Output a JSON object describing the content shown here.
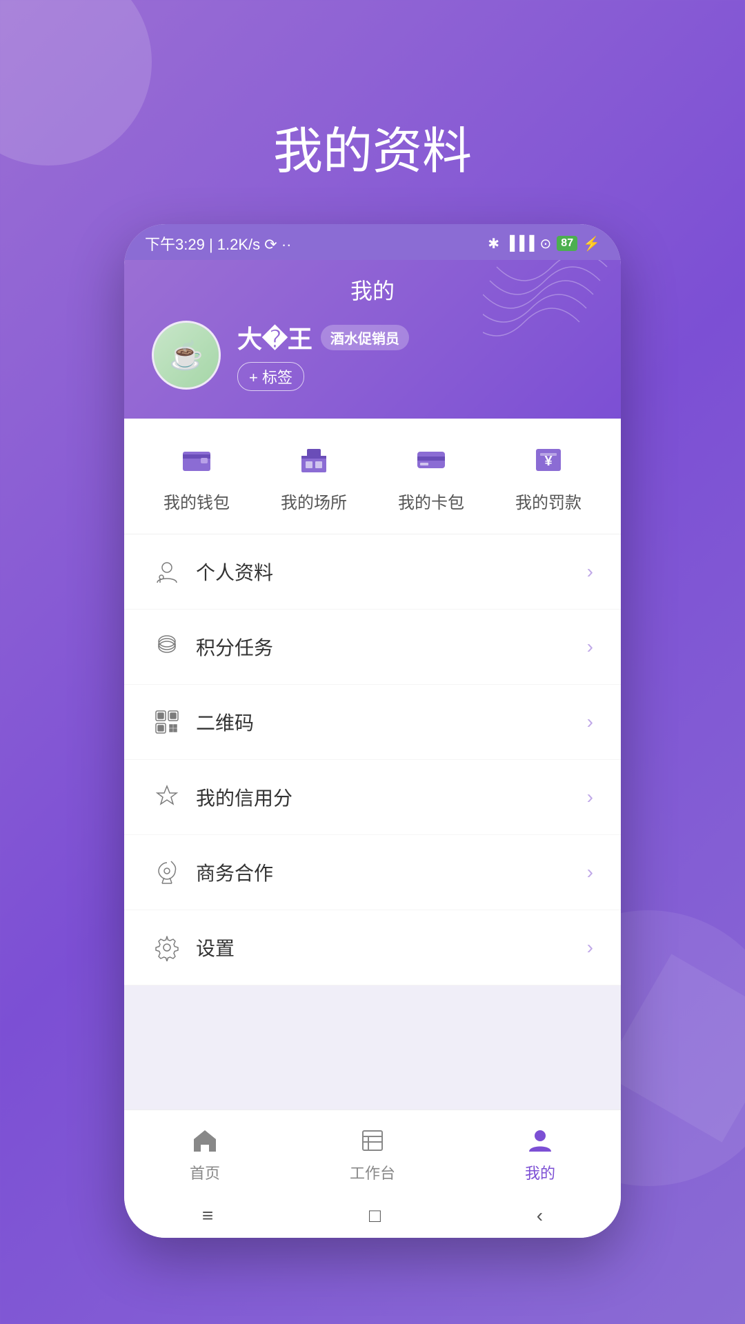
{
  "page": {
    "title": "我的资料",
    "background_color": "#8b6cd4"
  },
  "status_bar": {
    "time": "下午3:29",
    "network": "1.2K/s",
    "battery": "87"
  },
  "header": {
    "title": "我的",
    "user_name": "大�王",
    "role_badge": "酒水促销员",
    "tag_button": "+ 标签",
    "avatar_emoji": "☕"
  },
  "quick_menu": [
    {
      "id": "wallet",
      "label": "我的钱包"
    },
    {
      "id": "venue",
      "label": "我的场所"
    },
    {
      "id": "card",
      "label": "我的卡包"
    },
    {
      "id": "fine",
      "label": "我的罚款"
    }
  ],
  "menu_items": [
    {
      "id": "profile",
      "label": "个人资料"
    },
    {
      "id": "points",
      "label": "积分任务"
    },
    {
      "id": "qrcode",
      "label": "二维码"
    },
    {
      "id": "credit",
      "label": "我的信用分"
    },
    {
      "id": "business",
      "label": "商务合作"
    },
    {
      "id": "settings",
      "label": "设置"
    }
  ],
  "bottom_nav": [
    {
      "id": "home",
      "label": "首页",
      "active": false
    },
    {
      "id": "workbench",
      "label": "工作台",
      "active": false
    },
    {
      "id": "mine",
      "label": "我的",
      "active": true
    }
  ],
  "system_nav": {
    "menu": "≡",
    "home": "□",
    "back": "‹"
  }
}
